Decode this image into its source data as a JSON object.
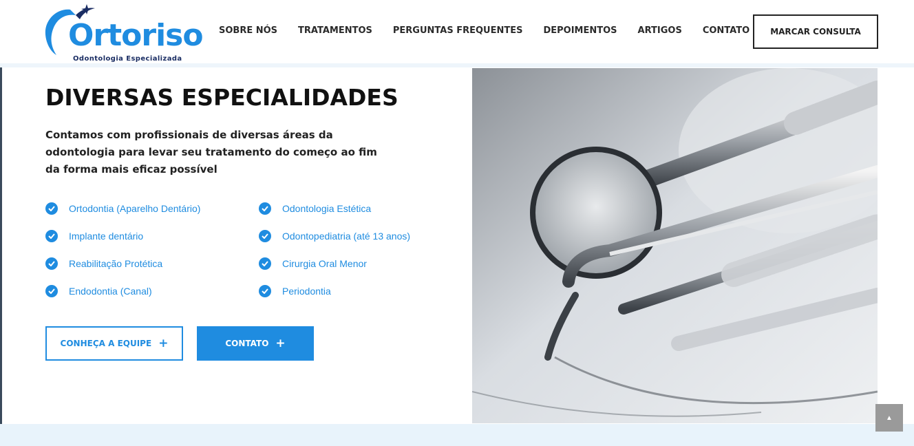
{
  "brand": {
    "name": "Ortoriso",
    "tagline": "Odontologia Especializada",
    "color": "#1f8ce0",
    "tagline_color": "#1a2d63"
  },
  "nav": {
    "items": [
      "SOBRE NÓS",
      "TRATAMENTOS",
      "PERGUNTAS FREQUENTES",
      "DEPOIMENTOS",
      "ARTIGOS",
      "CONTATO"
    ],
    "cta_label": "MARCAR CONSULTA"
  },
  "hero": {
    "title": "DIVERSAS ESPECIALIDADES",
    "intro": "Contamos com profissionais de diversas áreas da odontologia para levar seu tratamento do começo ao fim da forma mais eficaz possível",
    "specialties_left": [
      "Ortodontia (Aparelho Dentário)",
      "Implante dentário",
      "Reabilitação Protética",
      "Endodontia (Canal)"
    ],
    "specialties_right": [
      "Odontologia Estética",
      "Odontopediatria (até 13 anos)",
      "Cirurgia Oral Menor",
      "Periodontia"
    ],
    "buttons": {
      "team_label": "CONHEÇA A EQUIPE",
      "contact_label": "CONTATO",
      "plus": "+"
    }
  },
  "icons": {
    "check": "check-circle-icon",
    "scroll_top": "chevron-up-icon"
  },
  "scroll_top_symbol": "▲"
}
